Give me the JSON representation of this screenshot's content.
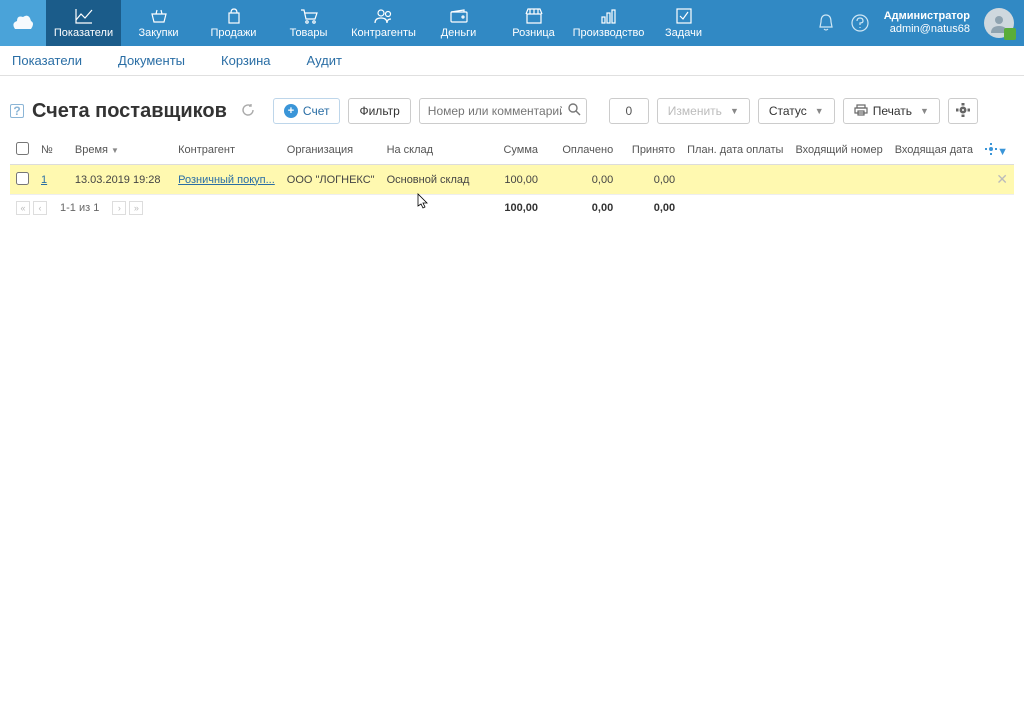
{
  "topnav": {
    "items": [
      {
        "label": "Показатели",
        "active": true
      },
      {
        "label": "Закупки"
      },
      {
        "label": "Продажи"
      },
      {
        "label": "Товары"
      },
      {
        "label": "Контрагенты"
      },
      {
        "label": "Деньги"
      },
      {
        "label": "Розница"
      },
      {
        "label": "Производство"
      },
      {
        "label": "Задачи"
      }
    ],
    "user_name": "Администратор",
    "user_email": "admin@natus68"
  },
  "subnav": {
    "tabs": [
      {
        "label": "Показатели"
      },
      {
        "label": "Документы"
      },
      {
        "label": "Корзина"
      },
      {
        "label": "Аудит"
      }
    ]
  },
  "toolbar": {
    "title": "Счета поставщиков",
    "new_btn": "Счет",
    "filter_btn": "Фильтр",
    "search_placeholder": "Номер или комментарий",
    "count": "0",
    "change_btn": "Изменить",
    "status_btn": "Статус",
    "print_btn": "Печать"
  },
  "table": {
    "headers": {
      "num": "№",
      "time": "Время",
      "contragent": "Контрагент",
      "org": "Организация",
      "warehouse": "На склад",
      "sum": "Сумма",
      "paid": "Оплачено",
      "received": "Принято",
      "plan_date": "План. дата оплаты",
      "incoming_num": "Входящий номер",
      "incoming_date": "Входящая дата"
    },
    "rows": [
      {
        "num": "1",
        "time": "13.03.2019 19:28",
        "contragent": "Розничный покуп...",
        "org": "ООО \"ЛОГНЕКС\"",
        "warehouse": "Основной склад",
        "sum": "100,00",
        "paid": "0,00",
        "received": "0,00"
      }
    ],
    "pager": "1-1 из 1",
    "totals": {
      "sum": "100,00",
      "paid": "0,00",
      "received": "0,00"
    }
  }
}
